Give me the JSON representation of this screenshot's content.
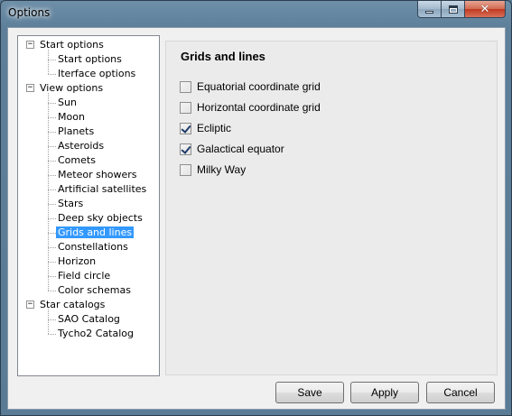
{
  "window": {
    "title": "Options"
  },
  "tree": {
    "groups": [
      {
        "label": "Start options",
        "children": [
          "Start options",
          "Iterface options"
        ]
      },
      {
        "label": "View options",
        "children": [
          "Sun",
          "Moon",
          "Planets",
          "Asteroids",
          "Comets",
          "Meteor showers",
          "Artificial satellites",
          "Stars",
          "Deep sky objects",
          "Grids and lines",
          "Constellations",
          "Horizon",
          "Field circle",
          "Color schemas"
        ]
      },
      {
        "label": "Star catalogs",
        "children": [
          "SAO Catalog",
          "Tycho2 Catalog"
        ]
      }
    ],
    "selected": "Grids and lines"
  },
  "panel": {
    "title": "Grids and lines",
    "options": [
      {
        "label": "Equatorial coordinate grid",
        "checked": false
      },
      {
        "label": "Horizontal coordinate grid",
        "checked": false
      },
      {
        "label": "Ecliptic",
        "checked": true
      },
      {
        "label": "Galactical equator",
        "checked": true
      },
      {
        "label": "Milky Way",
        "checked": false
      }
    ]
  },
  "buttons": {
    "save": "Save",
    "apply": "Apply",
    "cancel": "Cancel"
  }
}
